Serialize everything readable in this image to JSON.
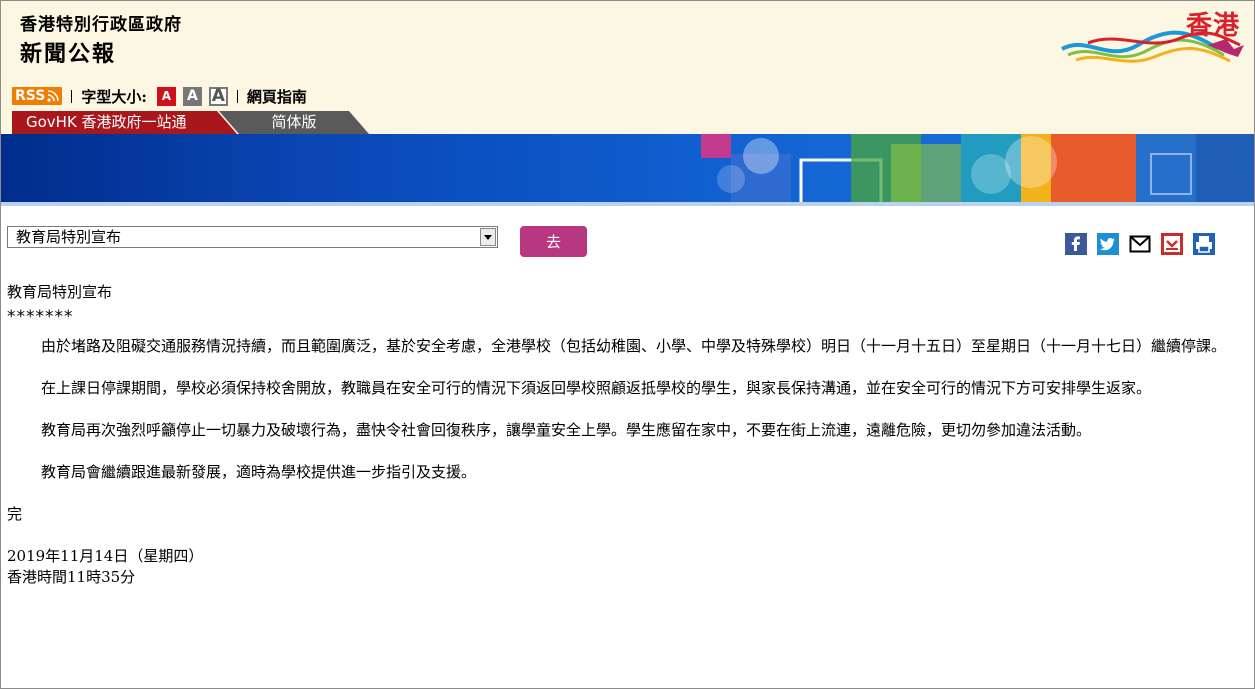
{
  "header": {
    "government": "香港特別行政區政府",
    "section": "新聞公報",
    "logo_text": "香港"
  },
  "toolbar": {
    "rss": "RSS",
    "font_size_label": "字型大小:",
    "font_sizes": [
      "A",
      "A",
      "A"
    ],
    "site_guide": "網頁指南"
  },
  "tabs": {
    "govhk": "GovHK 香港政府一站通",
    "simplified": "简体版"
  },
  "selector": {
    "selected": "教育局特別宣布",
    "go_label": "去"
  },
  "share_icons": [
    "facebook-icon",
    "twitter-icon",
    "email-icon",
    "bookmark-icon",
    "print-icon"
  ],
  "article": {
    "title": "教育局特別宣布",
    "stars": "*******",
    "paragraphs": [
      "由於堵路及阻礙交通服務情況持續，而且範圍廣泛，基於安全考慮，全港學校（包括幼稚園、小學、中學及特殊學校）明日（十一月十五日）至星期日（十一月十七日）繼續停課。",
      "在上課日停課期間，學校必須保持校舍開放，教職員在安全可行的情況下須返回學校照顧返抵學校的學生，與家長保持溝通，並在安全可行的情況下方可安排學生返家。",
      "教育局再次強烈呼籲停止一切暴力及破壞行為，盡快令社會回復秩序，讓學童安全上學。學生應留在家中，不要在街上流連，遠離危險，更切勿參加違法活動。",
      "教育局會繼續跟進最新發展，適時為學校提供進一步指引及支援。"
    ],
    "end": "完",
    "date": "2019年11月14日（星期四）",
    "time": "香港時間11時35分"
  },
  "colors": {
    "header_bg": "#fbf7e2",
    "rss": "#f07c00",
    "govhk_tab": "#a8171c",
    "simplified_tab": "#5a5a5a",
    "go_button": "#b73881",
    "logo": "#d9212c"
  }
}
